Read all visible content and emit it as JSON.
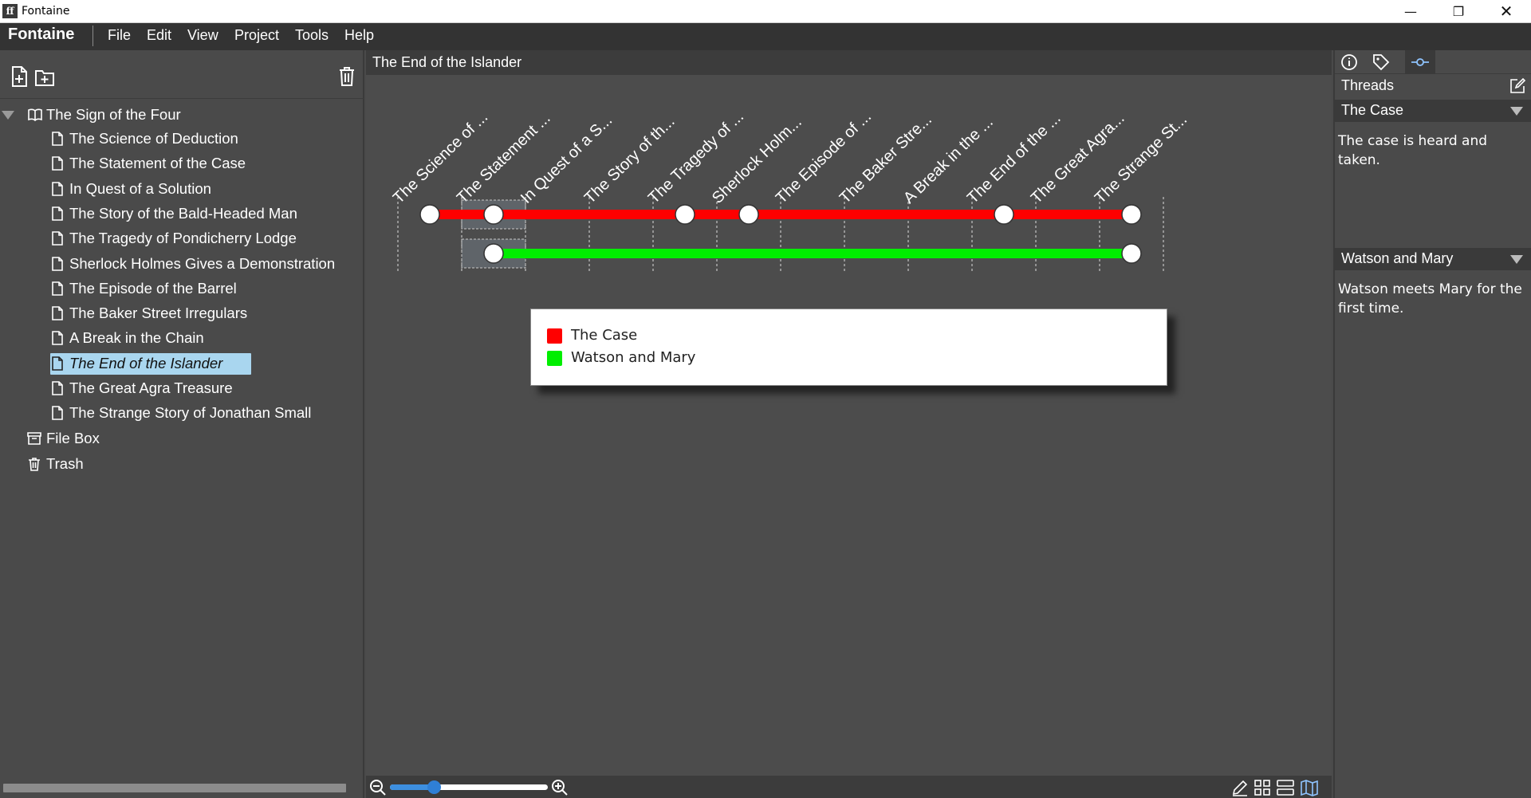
{
  "window": {
    "title": "Fontaine",
    "app_icon": "ff",
    "controls": {
      "minimize": "—",
      "maximize": "❐",
      "close": "✕"
    }
  },
  "menubar": {
    "brand": "Fontaine",
    "items": [
      "File",
      "Edit",
      "View",
      "Project",
      "Tools",
      "Help"
    ]
  },
  "sidebar": {
    "tools": [
      "new-document-icon",
      "new-folder-icon",
      "trash-icon"
    ],
    "project": {
      "label": "The Sign of the Four",
      "icon": "book-icon"
    },
    "chapters": [
      "The Science of Deduction",
      "The Statement of the Case",
      "In Quest of a Solution",
      "The Story of the Bald-Headed Man",
      "The Tragedy of Pondicherry Lodge",
      "Sherlock Holmes Gives a Demonstration",
      "The Episode of the Barrel",
      "The Baker Street Irregulars",
      "A Break in the Chain",
      "The End of the Islander",
      "The Great Agra Treasure",
      "The Strange Story of Jonathan Small"
    ],
    "selected_index": 9,
    "extras": [
      {
        "label": "File Box",
        "icon": "archive-box-icon"
      },
      {
        "label": "Trash",
        "icon": "trash-icon"
      }
    ]
  },
  "center": {
    "document_title": "The End of the Islander",
    "columns": [
      "The Science of ...",
      "The Statement ...",
      "In Quest of a S...",
      "The Story of th...",
      "The Tragedy of ...",
      "Sherlock Holm...",
      "The Episode of ...",
      "The Baker Stre...",
      "A Break in the ...",
      "The End of the ...",
      "The Great Agra...",
      "The Strange St..."
    ],
    "highlighted_column": 1,
    "threads": [
      {
        "name": "The Case",
        "color": "#ff0000",
        "start": 0,
        "end": 11,
        "nodes": [
          0,
          1,
          4,
          5,
          9,
          11
        ]
      },
      {
        "name": "Watson and Mary",
        "color": "#00ee00",
        "start": 1,
        "end": 11,
        "nodes": [
          1,
          11
        ]
      }
    ],
    "zoom_fraction": 0.28,
    "bottom_icons": [
      "zoom-out-icon",
      "zoom-in-icon",
      "edit-view-icon",
      "grid-view-icon",
      "outline-view-icon",
      "map-view-icon"
    ]
  },
  "right_panel": {
    "tabs": [
      "info-icon",
      "tag-icon",
      "thread-icon"
    ],
    "active_tab": 2,
    "heading": "Threads",
    "sections": [
      {
        "title": "The Case",
        "description": "The case is heard and taken."
      },
      {
        "title": "Watson and Mary",
        "description": "Watson meets Mary for the first time."
      }
    ]
  }
}
